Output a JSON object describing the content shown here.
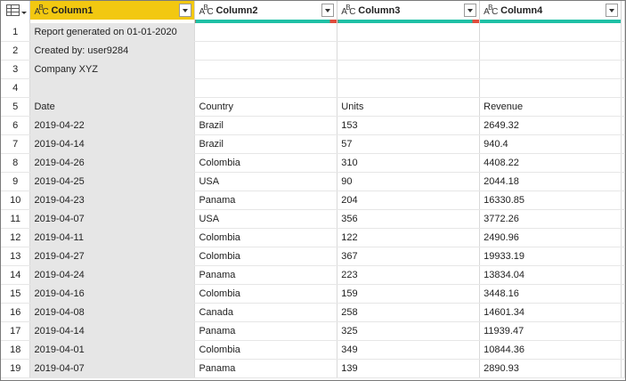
{
  "columns": [
    {
      "name": "Column1",
      "type_icon": "abc-type-icon"
    },
    {
      "name": "Column2",
      "type_icon": "abc-type-icon"
    },
    {
      "name": "Column3",
      "type_icon": "abc-type-icon"
    },
    {
      "name": "Column4",
      "type_icon": "abc-type-icon"
    }
  ],
  "colors": {
    "selected_header": "#f2c811",
    "quality_valid": "#1fc0a5",
    "quality_error": "#e14c3c"
  },
  "rows": [
    {
      "n": "1",
      "cells": [
        "Report generated on 01-01-2020",
        "",
        "",
        ""
      ]
    },
    {
      "n": "2",
      "cells": [
        "Created by: user9284",
        "",
        "",
        ""
      ]
    },
    {
      "n": "3",
      "cells": [
        "Company XYZ",
        "",
        "",
        ""
      ]
    },
    {
      "n": "4",
      "cells": [
        "",
        "",
        "",
        ""
      ]
    },
    {
      "n": "5",
      "cells": [
        "Date",
        "Country",
        "Units",
        "Revenue"
      ]
    },
    {
      "n": "6",
      "cells": [
        "2019-04-22",
        "Brazil",
        "153",
        "2649.32"
      ]
    },
    {
      "n": "7",
      "cells": [
        "2019-04-14",
        "Brazil",
        "57",
        "940.4"
      ]
    },
    {
      "n": "8",
      "cells": [
        "2019-04-26",
        "Colombia",
        "310",
        "4408.22"
      ]
    },
    {
      "n": "9",
      "cells": [
        "2019-04-25",
        "USA",
        "90",
        "2044.18"
      ]
    },
    {
      "n": "10",
      "cells": [
        "2019-04-23",
        "Panama",
        "204",
        "16330.85"
      ]
    },
    {
      "n": "11",
      "cells": [
        "2019-04-07",
        "USA",
        "356",
        "3772.26"
      ]
    },
    {
      "n": "12",
      "cells": [
        "2019-04-11",
        "Colombia",
        "122",
        "2490.96"
      ]
    },
    {
      "n": "13",
      "cells": [
        "2019-04-27",
        "Colombia",
        "367",
        "19933.19"
      ]
    },
    {
      "n": "14",
      "cells": [
        "2019-04-24",
        "Panama",
        "223",
        "13834.04"
      ]
    },
    {
      "n": "15",
      "cells": [
        "2019-04-16",
        "Colombia",
        "159",
        "3448.16"
      ]
    },
    {
      "n": "16",
      "cells": [
        "2019-04-08",
        "Canada",
        "258",
        "14601.34"
      ]
    },
    {
      "n": "17",
      "cells": [
        "2019-04-14",
        "Panama",
        "325",
        "11939.47"
      ]
    },
    {
      "n": "18",
      "cells": [
        "2019-04-01",
        "Colombia",
        "349",
        "10844.36"
      ]
    },
    {
      "n": "19",
      "cells": [
        "2019-04-07",
        "Panama",
        "139",
        "2890.93"
      ]
    }
  ]
}
